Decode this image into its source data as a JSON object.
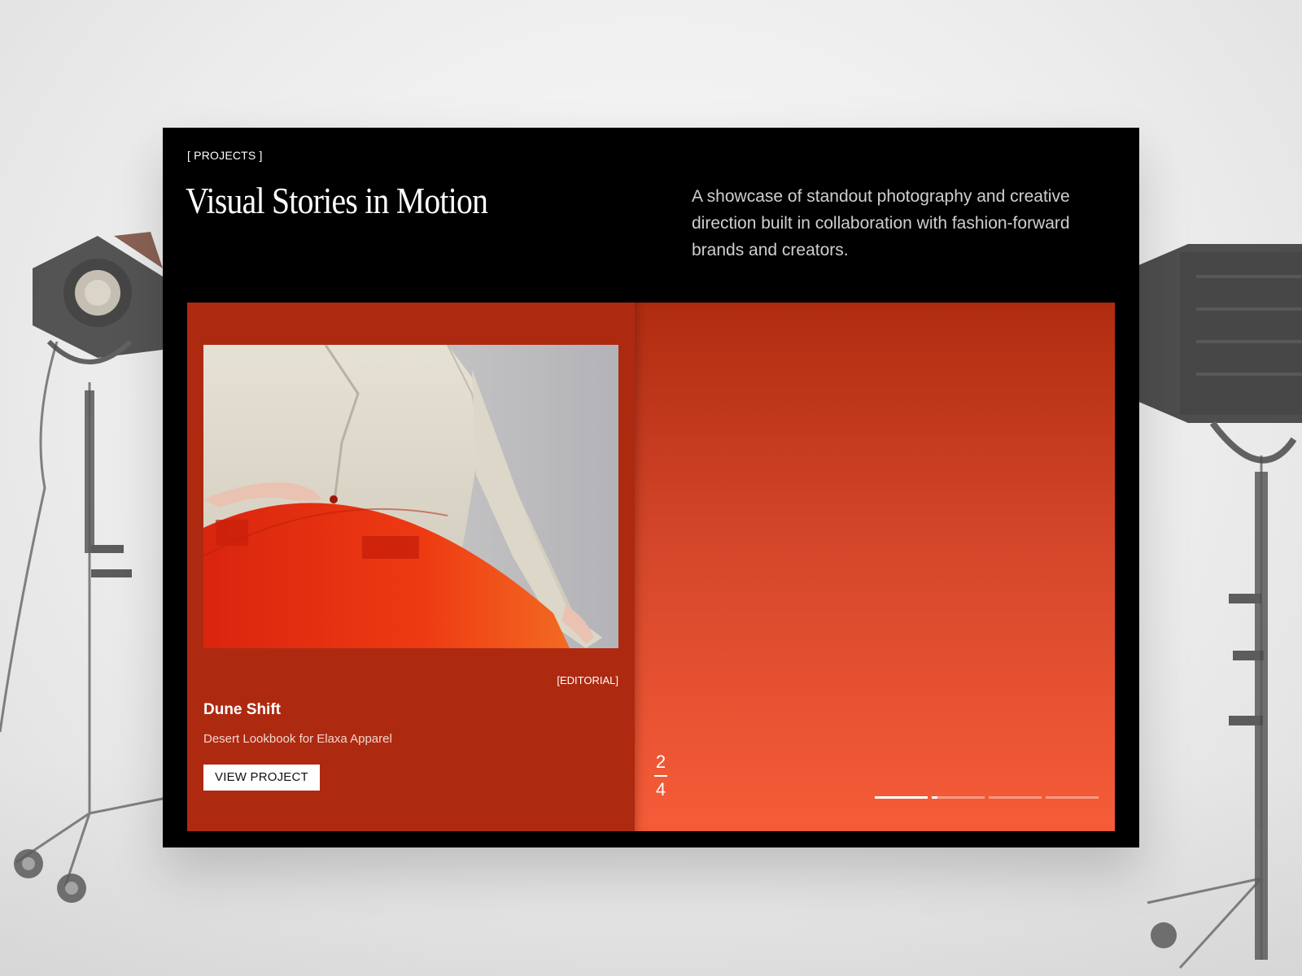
{
  "header": {
    "kicker": "[ PROJECTS ]",
    "title": "Visual Stories in Motion",
    "intro": "A showcase of standout photography and creative direction built in collaboration with fashion-forward brands and creators."
  },
  "active_card": {
    "tag": "[EDITORIAL]",
    "title": "Dune Shift",
    "subtitle": "Desert Lookbook for Elaxa Apparel",
    "button_label": "VIEW PROJECT",
    "image_icon": "fashion-photo"
  },
  "pagination": {
    "current": "2",
    "total": "4",
    "segment_progress": [
      1.0,
      0.1,
      0.0,
      0.0
    ]
  },
  "colors": {
    "panel_bg": "#000000",
    "card_bg": "#ad2a11",
    "accent_orange": "#f65c38"
  }
}
